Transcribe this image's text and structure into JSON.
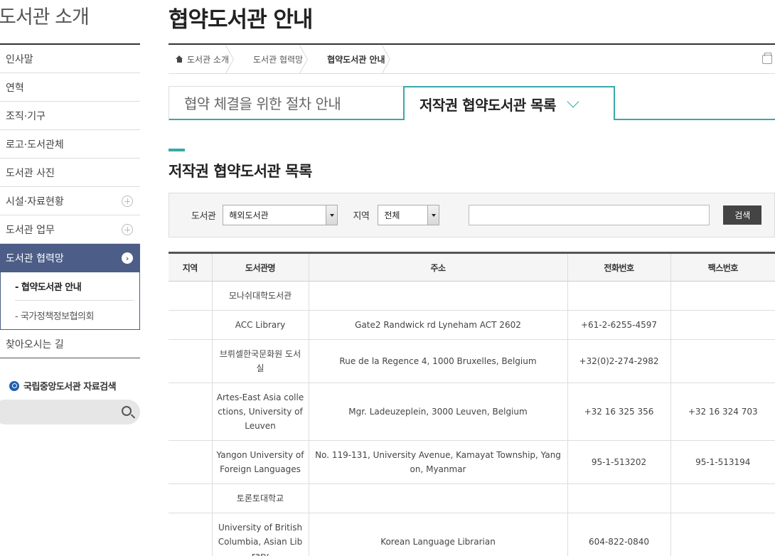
{
  "sidebar": {
    "title": "도서관 소개",
    "items": [
      {
        "label": "인사말"
      },
      {
        "label": "연혁"
      },
      {
        "label": "조직·기구"
      },
      {
        "label": "로고·도서관체"
      },
      {
        "label": "도서관 사진"
      },
      {
        "label": "시설·자료현황"
      },
      {
        "label": "도서관 업무"
      },
      {
        "label": "도서관 협력망"
      },
      {
        "label": "찾아오시는 길"
      }
    ],
    "sub_items": [
      {
        "label": "- 협약도서관 안내"
      },
      {
        "label": "- 국가정책정보협의회"
      }
    ],
    "search_label": "국립중앙도서관 자료검색"
  },
  "header": {
    "title": "협약도서관 안내"
  },
  "breadcrumb": [
    "도서관 소개",
    "도서관 협력망",
    "협약도서관 안내"
  ],
  "tabs": [
    {
      "label": "협약 체결을 위한 절차 안내"
    },
    {
      "label": "저작권 협약도서관 목록"
    }
  ],
  "section_title": "저작권 협약도서관 목록",
  "search": {
    "library_label": "도서관",
    "library_value": "해외도서관",
    "region_label": "지역",
    "region_value": "전체",
    "keyword_value": "",
    "button_label": "검색"
  },
  "table": {
    "headers": [
      "지역",
      "도서관명",
      "주소",
      "전화번호",
      "팩스번호"
    ],
    "rows": [
      [
        "",
        "모나쉬대학도서관",
        "",
        "",
        ""
      ],
      [
        "",
        "ACC Library",
        "Gate2 Randwick rd Lyneham ACT 2602",
        "+61-2-6255-4597",
        ""
      ],
      [
        "",
        "브뤼셀한국문화원 도서실",
        "Rue de la Regence 4, 1000 Bruxelles, Belgium",
        "+32(0)2-274-2982",
        ""
      ],
      [
        "",
        "Artes-East Asia collections, University of Leuven",
        "Mgr. Ladeuzeplein, 3000 Leuven, Belgium",
        "+32 16 325 356",
        "+32 16 324 703"
      ],
      [
        "",
        "Yangon University of Foreign Languages",
        "No. 119-131, University Avenue, Kamayat Township, Yangon, Myanmar",
        "95-1-513202",
        "95-1-513194"
      ],
      [
        "",
        "토론토대학교",
        "",
        "",
        ""
      ],
      [
        "",
        "University of British Columbia, Asian Library",
        "Korean Language Librarian",
        "604-822-0840",
        ""
      ]
    ]
  },
  "colors": {
    "accent": "#3aa8a8",
    "sidebar_active": "#4c5d87",
    "button": "#444444"
  }
}
